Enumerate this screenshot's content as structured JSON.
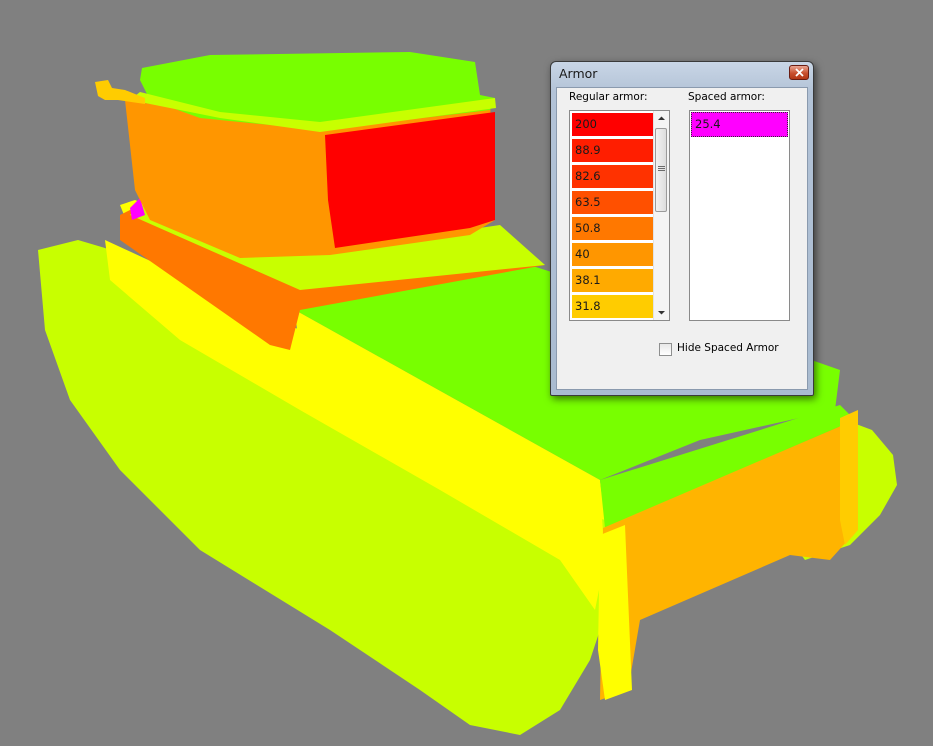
{
  "window": {
    "title": "Armor",
    "close_icon": "close-icon"
  },
  "armor_panel": {
    "regular_label": "Regular armor:",
    "spaced_label": "Spaced armor:",
    "hide_spaced_label": "Hide Spaced Armor",
    "hide_spaced_checked": false,
    "regular_items": [
      {
        "value": "200",
        "color": "#ff0000"
      },
      {
        "value": "88.9",
        "color": "#ff1e00"
      },
      {
        "value": "82.6",
        "color": "#ff3200"
      },
      {
        "value": "63.5",
        "color": "#ff5000"
      },
      {
        "value": "50.8",
        "color": "#ff7800"
      },
      {
        "value": "40",
        "color": "#ff9600"
      },
      {
        "value": "38.1",
        "color": "#ffaa00"
      },
      {
        "value": "31.8",
        "color": "#ffcc00"
      }
    ],
    "spaced_items": [
      {
        "value": "25.4",
        "color": "#ff00ff"
      }
    ]
  },
  "scene": {
    "background_color": "#808080",
    "model_colors": {
      "track": "#c8ff00",
      "deck": "#78ff00",
      "side_yellow": "#ffff00",
      "rear_plate": "#ffb400",
      "turret_front": "#ff0000",
      "turret_side": "#ff9600",
      "hull_orange": "#ff7800",
      "spaced": "#ff00ff"
    }
  }
}
